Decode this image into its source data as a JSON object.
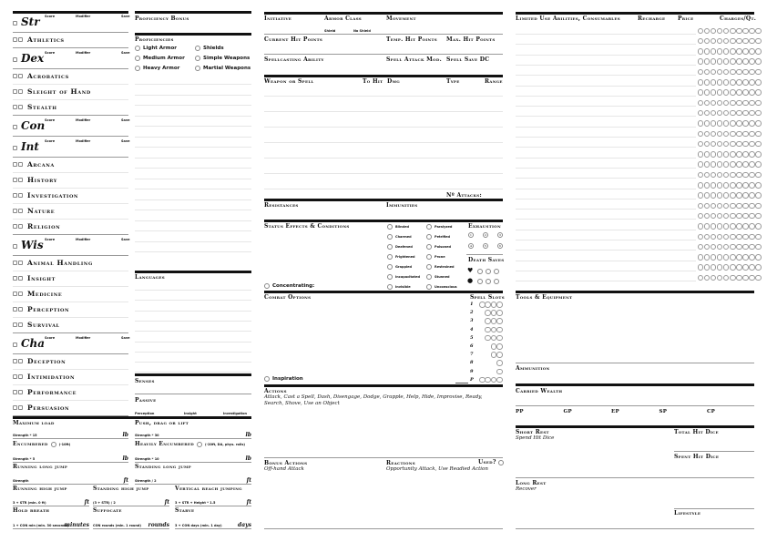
{
  "abilities": {
    "column_labels": {
      "score": "Score",
      "modifier": "Modifier",
      "save": "Save"
    },
    "blocks": [
      {
        "name": "Str",
        "skills": [
          "Athletics"
        ]
      },
      {
        "name": "Dex",
        "skills": [
          "Acrobatics",
          "Sleight of Hand",
          "Stealth"
        ]
      },
      {
        "name": "Con",
        "skills": []
      },
      {
        "name": "Int",
        "skills": [
          "Arcana",
          "History",
          "Investigation",
          "Nature",
          "Religion"
        ]
      },
      {
        "name": "Wis",
        "skills": [
          "Animal Handling",
          "Insight",
          "Medicine",
          "Perception",
          "Survival"
        ]
      },
      {
        "name": "Cha",
        "skills": [
          "Deception",
          "Intimidation",
          "Performance",
          "Persuasion"
        ]
      }
    ]
  },
  "proficiency": {
    "bonus_label": "Proficiency Bonus",
    "proficiencies_label": "Proficiencies",
    "items": [
      "Light Armor",
      "Shields",
      "Medium Armor",
      "Simple Weapons",
      "Heavy Armor",
      "Martial Weapons"
    ],
    "languages_label": "Languages",
    "senses_label": "Senses",
    "passive_label": "Passive",
    "passive_items": [
      "Perception",
      "Insight",
      "Investigation"
    ]
  },
  "carry": {
    "max_load": {
      "label": "Maximum load",
      "formula": "Strength * 15",
      "unit": "lb"
    },
    "push": {
      "label": "Push, drag or lift",
      "formula": "Strength * 30",
      "unit": "lb"
    },
    "encumbered": {
      "label": "Encumbered",
      "note": "(-10ft)",
      "formula": "Strength * 5",
      "unit": "lb"
    },
    "heavily": {
      "label": "Heavily Encumbered",
      "note": "(-20ft, DA, phys. rolls)",
      "formula": "Strength * 10",
      "unit": "lb"
    },
    "run_long": {
      "label": "Running long jump",
      "formula": "Strength",
      "unit": "ft"
    },
    "stand_long": {
      "label": "Standing long jump",
      "formula": "Strength / 2",
      "unit": "ft"
    },
    "run_high": {
      "label": "Running high jump",
      "formula": "3 + STR (min. 0 ft)",
      "unit": "ft"
    },
    "stand_high": {
      "label": "Standing high jump",
      "formula": "(3 + STR) / 2",
      "unit": "ft"
    },
    "vert_reach": {
      "label": "Vertical reach jumping",
      "formula": "3 + STR + Height * 1.5",
      "unit": "ft"
    },
    "hold": {
      "label": "Hold breath",
      "formula": "1 + CON min (min. 30 seconds)",
      "unit": "minutes"
    },
    "suffocate": {
      "label": "Suffocate",
      "formula": "CON rounds (min. 1 round)",
      "unit": "rounds"
    },
    "starve": {
      "label": "Starve",
      "formula": "3 + CON days (min. 1 day)",
      "unit": "days"
    }
  },
  "combat": {
    "initiative": "Initiative",
    "armor_class": "Armor Class",
    "shield": "Shield",
    "no_shield": "No Shield",
    "movement": "Movement",
    "current_hp": "Current Hit Points",
    "temp_hp": "Temp. Hit Points",
    "max_hp": "Max. Hit Points",
    "spell_ability": "Spellcasting Ability",
    "spell_attack": "Spell Attack Mod.",
    "spell_dc": "Spell Save DC",
    "weapons_header": {
      "weapon": "Weapon or Spell",
      "to_hit": "To Hit",
      "dmg": "Dmg",
      "type": "Type",
      "range": "Range"
    },
    "num_attacks": "Nº Attacks:",
    "resistances": "Resistances",
    "immunities": "Immunities",
    "status_label": "Status Effects & Conditions",
    "conditions_left": [
      "Blinded",
      "Charmed",
      "Deafened",
      "Frightened",
      "Grappled",
      "Incapacitated",
      "Invisible"
    ],
    "conditions_right": [
      "Paralyzed",
      "Petrified",
      "Poisoned",
      "Prone",
      "Restrained",
      "Stunned",
      "Unconscious"
    ],
    "exhaustion_label": "Exhaustion",
    "exhaustion_levels": [
      "1",
      "2",
      "3",
      "4",
      "5",
      "6"
    ],
    "death_saves_label": "Death Saves",
    "concentrating": "Concentrating:",
    "combat_options": "Combat Options",
    "spell_slots_label": "Spell Slots",
    "spell_slots": [
      {
        "level": "1",
        "slots": 4
      },
      {
        "level": "2",
        "slots": 3
      },
      {
        "level": "3",
        "slots": 3
      },
      {
        "level": "4",
        "slots": 3
      },
      {
        "level": "5",
        "slots": 3
      },
      {
        "level": "6",
        "slots": 2
      },
      {
        "level": "7",
        "slots": 2
      },
      {
        "level": "8",
        "slots": 1
      },
      {
        "level": "9",
        "slots": 1
      },
      {
        "level": "P",
        "slots": 4
      }
    ],
    "inspiration": "Inspiration",
    "actions_label": "Actions",
    "actions_text": "Attack, Cast a Spell, Dash, Disengage, Dodge, Grapple, Help, Hide, Improvise, Ready, Search, Shove, Use an Object",
    "bonus_label": "Bonus Actions",
    "bonus_text": "Off-hand Attack",
    "reactions_label": "Reactions",
    "reactions_text": "Opportunity Attack, Use Readied Action",
    "used_label": "Used?"
  },
  "inventory": {
    "limited_label": "Limited Use Abilities, Consumables",
    "recharge": "Recharge",
    "price": "Price",
    "charges": "Charges/Qt.",
    "rows": 25,
    "circles_per_row": 10,
    "tools_label": "Tools & Equipment",
    "ammo_label": "Ammunition",
    "wealth_label": "Carried Wealth",
    "coins": [
      "PP",
      "GP",
      "EP",
      "SP",
      "CP"
    ],
    "short_rest": "Short Rest",
    "short_rest_text": "Spend Hit Dice",
    "total_hd": "Total Hit Dice",
    "spent_hd": "Spent Hit Dice",
    "long_rest": "Long Rest",
    "long_rest_text": "Recover",
    "lifestyle": "Lifestyle"
  }
}
